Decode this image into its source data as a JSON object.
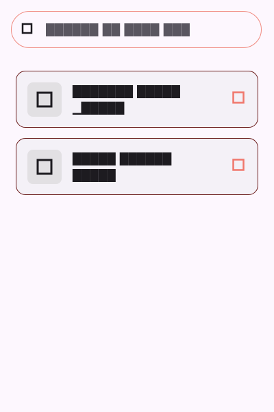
{
  "colors": {
    "background": "#fdf7fe",
    "search_outline": "#f08a80",
    "card_outline": "#6b1b1b",
    "card_background": "#f4f1f7",
    "thumb_background": "#e2e0e3",
    "accent_icon": "#f0776c",
    "text": "#1d1b20"
  },
  "search": {
    "icon": "checkbox-icon",
    "placeholder": "██████ ██ ████ ███"
  },
  "items": [
    {
      "icon": "square-icon",
      "title": "███████ █████ ▁█████",
      "trailing_icon": "square-outline-icon"
    },
    {
      "icon": "square-icon",
      "title": "█████ ██████ █████",
      "trailing_icon": "square-outline-icon"
    }
  ]
}
